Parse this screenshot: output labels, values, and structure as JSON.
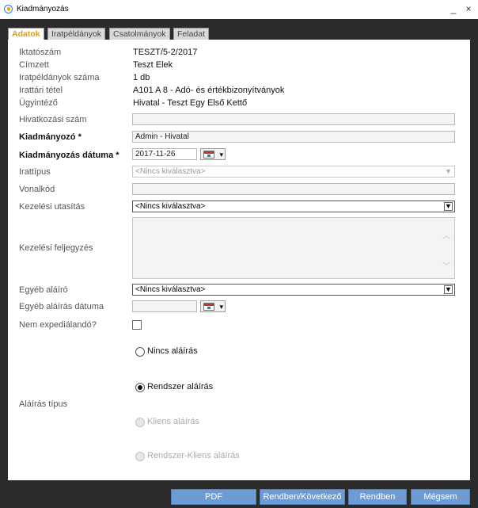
{
  "window": {
    "title": "Kiadmányozás",
    "minimize": "_",
    "close": "×"
  },
  "tabs": [
    {
      "label": "Adatok",
      "active": true
    },
    {
      "label": "Iratpéldányok",
      "active": false
    },
    {
      "label": "Csatolmányok",
      "active": false
    },
    {
      "label": "Feladat",
      "active": false
    }
  ],
  "info": [
    {
      "label": "Iktatószám",
      "value": "TESZT/5-2/2017"
    },
    {
      "label": "Címzett",
      "value": "Teszt Elek"
    },
    {
      "label": "Iratpéldányok száma",
      "value": "1 db"
    },
    {
      "label": "Irattári tétel",
      "value": "A101 A 8 - Adó- és értékbizonyítványok"
    },
    {
      "label": "Ügyintéző",
      "value": "Hivatal - Teszt Egy Első Kettő"
    }
  ],
  "form": {
    "hivatkozasi_szam": {
      "label": "Hivatkozási szám",
      "value": ""
    },
    "kiadmanyozo": {
      "label": "Kiadmányozó *",
      "value": "Admin - Hivatal"
    },
    "kiadmanyozas_datuma": {
      "label": "Kiadmányozás dátuma *",
      "value": "2017-11-26"
    },
    "irattipus": {
      "label": "Irattípus",
      "selected": "<Nincs kiválasztva>"
    },
    "vonalkod": {
      "label": "Vonalkód",
      "value": ""
    },
    "kezelesi_utasitas": {
      "label": "Kezelési utasítás",
      "selected": "<Nincs kiválasztva>"
    },
    "kezelesi_feljegyzes": {
      "label": "Kezelési feljegyzés",
      "value": ""
    },
    "egyeb_alairo": {
      "label": "Egyéb aláíró",
      "selected": "<Nincs kiválasztva>"
    },
    "egyeb_alairas_datuma": {
      "label": "Egyéb aláírás dátuma",
      "value": ""
    },
    "nem_expedialando": {
      "label": "Nem expediálandó?",
      "checked": false
    }
  },
  "alairas_tipus": {
    "label": "Aláírás típus",
    "options": [
      {
        "label": "Nincs aláírás",
        "checked": false,
        "disabled": false
      },
      {
        "label": "Rendszer aláírás",
        "checked": true,
        "disabled": false
      },
      {
        "label": "Kliens aláírás",
        "checked": false,
        "disabled": true
      },
      {
        "label": "Rendszer-Kliens aláírás",
        "checked": false,
        "disabled": true
      }
    ]
  },
  "buttons": {
    "pdf": "PDF",
    "next": "Rendben/Következő",
    "ok": "Rendben",
    "cancel": "Mégsem"
  },
  "colors": {
    "active_tab": "#e0a000",
    "button": "#6f9bd3",
    "frame": "#2b2b2b"
  }
}
